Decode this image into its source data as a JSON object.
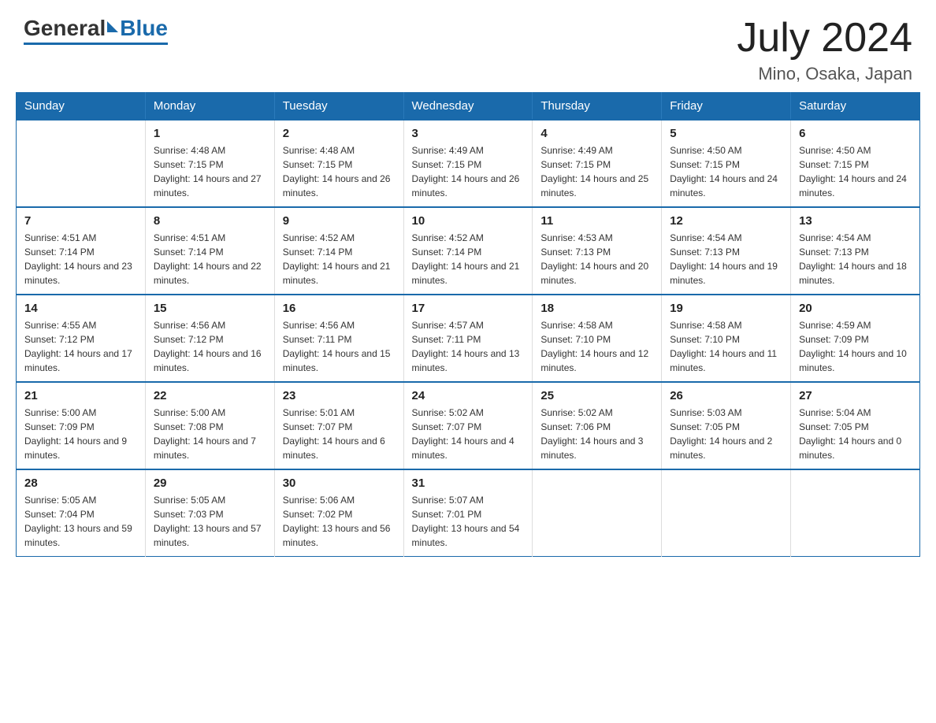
{
  "logo": {
    "general": "General",
    "blue": "Blue"
  },
  "header": {
    "month": "July 2024",
    "location": "Mino, Osaka, Japan"
  },
  "weekdays": [
    "Sunday",
    "Monday",
    "Tuesday",
    "Wednesday",
    "Thursday",
    "Friday",
    "Saturday"
  ],
  "weeks": [
    [
      null,
      {
        "day": "1",
        "sunrise": "4:48 AM",
        "sunset": "7:15 PM",
        "daylight": "14 hours and 27 minutes."
      },
      {
        "day": "2",
        "sunrise": "4:48 AM",
        "sunset": "7:15 PM",
        "daylight": "14 hours and 26 minutes."
      },
      {
        "day": "3",
        "sunrise": "4:49 AM",
        "sunset": "7:15 PM",
        "daylight": "14 hours and 26 minutes."
      },
      {
        "day": "4",
        "sunrise": "4:49 AM",
        "sunset": "7:15 PM",
        "daylight": "14 hours and 25 minutes."
      },
      {
        "day": "5",
        "sunrise": "4:50 AM",
        "sunset": "7:15 PM",
        "daylight": "14 hours and 24 minutes."
      },
      {
        "day": "6",
        "sunrise": "4:50 AM",
        "sunset": "7:15 PM",
        "daylight": "14 hours and 24 minutes."
      }
    ],
    [
      {
        "day": "7",
        "sunrise": "4:51 AM",
        "sunset": "7:14 PM",
        "daylight": "14 hours and 23 minutes."
      },
      {
        "day": "8",
        "sunrise": "4:51 AM",
        "sunset": "7:14 PM",
        "daylight": "14 hours and 22 minutes."
      },
      {
        "day": "9",
        "sunrise": "4:52 AM",
        "sunset": "7:14 PM",
        "daylight": "14 hours and 21 minutes."
      },
      {
        "day": "10",
        "sunrise": "4:52 AM",
        "sunset": "7:14 PM",
        "daylight": "14 hours and 21 minutes."
      },
      {
        "day": "11",
        "sunrise": "4:53 AM",
        "sunset": "7:13 PM",
        "daylight": "14 hours and 20 minutes."
      },
      {
        "day": "12",
        "sunrise": "4:54 AM",
        "sunset": "7:13 PM",
        "daylight": "14 hours and 19 minutes."
      },
      {
        "day": "13",
        "sunrise": "4:54 AM",
        "sunset": "7:13 PM",
        "daylight": "14 hours and 18 minutes."
      }
    ],
    [
      {
        "day": "14",
        "sunrise": "4:55 AM",
        "sunset": "7:12 PM",
        "daylight": "14 hours and 17 minutes."
      },
      {
        "day": "15",
        "sunrise": "4:56 AM",
        "sunset": "7:12 PM",
        "daylight": "14 hours and 16 minutes."
      },
      {
        "day": "16",
        "sunrise": "4:56 AM",
        "sunset": "7:11 PM",
        "daylight": "14 hours and 15 minutes."
      },
      {
        "day": "17",
        "sunrise": "4:57 AM",
        "sunset": "7:11 PM",
        "daylight": "14 hours and 13 minutes."
      },
      {
        "day": "18",
        "sunrise": "4:58 AM",
        "sunset": "7:10 PM",
        "daylight": "14 hours and 12 minutes."
      },
      {
        "day": "19",
        "sunrise": "4:58 AM",
        "sunset": "7:10 PM",
        "daylight": "14 hours and 11 minutes."
      },
      {
        "day": "20",
        "sunrise": "4:59 AM",
        "sunset": "7:09 PM",
        "daylight": "14 hours and 10 minutes."
      }
    ],
    [
      {
        "day": "21",
        "sunrise": "5:00 AM",
        "sunset": "7:09 PM",
        "daylight": "14 hours and 9 minutes."
      },
      {
        "day": "22",
        "sunrise": "5:00 AM",
        "sunset": "7:08 PM",
        "daylight": "14 hours and 7 minutes."
      },
      {
        "day": "23",
        "sunrise": "5:01 AM",
        "sunset": "7:07 PM",
        "daylight": "14 hours and 6 minutes."
      },
      {
        "day": "24",
        "sunrise": "5:02 AM",
        "sunset": "7:07 PM",
        "daylight": "14 hours and 4 minutes."
      },
      {
        "day": "25",
        "sunrise": "5:02 AM",
        "sunset": "7:06 PM",
        "daylight": "14 hours and 3 minutes."
      },
      {
        "day": "26",
        "sunrise": "5:03 AM",
        "sunset": "7:05 PM",
        "daylight": "14 hours and 2 minutes."
      },
      {
        "day": "27",
        "sunrise": "5:04 AM",
        "sunset": "7:05 PM",
        "daylight": "14 hours and 0 minutes."
      }
    ],
    [
      {
        "day": "28",
        "sunrise": "5:05 AM",
        "sunset": "7:04 PM",
        "daylight": "13 hours and 59 minutes."
      },
      {
        "day": "29",
        "sunrise": "5:05 AM",
        "sunset": "7:03 PM",
        "daylight": "13 hours and 57 minutes."
      },
      {
        "day": "30",
        "sunrise": "5:06 AM",
        "sunset": "7:02 PM",
        "daylight": "13 hours and 56 minutes."
      },
      {
        "day": "31",
        "sunrise": "5:07 AM",
        "sunset": "7:01 PM",
        "daylight": "13 hours and 54 minutes."
      },
      null,
      null,
      null
    ]
  ]
}
